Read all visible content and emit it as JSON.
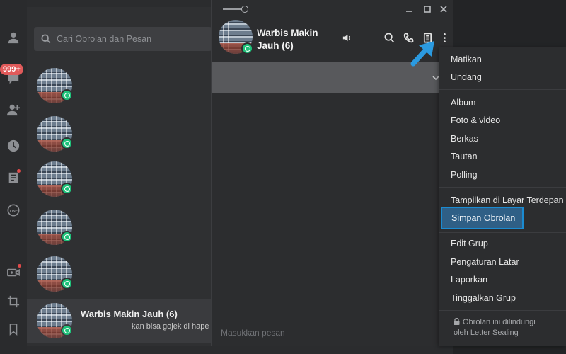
{
  "rail": {
    "badge": "999+",
    "icons": [
      "person-icon",
      "chat-icon",
      "add-friend-icon",
      "clock-icon",
      "timeline-icon",
      "line-icon",
      "video-call-icon",
      "crop-icon",
      "bookmark-icon"
    ]
  },
  "chat_list": {
    "search_placeholder": "Cari Obrolan dan Pesan",
    "items": [
      {
        "name": "",
        "preview": ""
      },
      {
        "name": "",
        "preview": ""
      },
      {
        "name": "",
        "preview": ""
      },
      {
        "name": "",
        "preview": ""
      },
      {
        "name": "",
        "preview": ""
      },
      {
        "name": "Warbis Makin Jauh (6)",
        "preview": "kan bisa gojek di hape l"
      }
    ]
  },
  "chat": {
    "title": "Warbis Makin Jauh (6)",
    "input_placeholder": "Masukkan pesan"
  },
  "menu": {
    "group1": [
      "Matikan",
      "Undang"
    ],
    "group2": [
      "Album",
      "Foto & video",
      "Berkas",
      "Tautan",
      "Polling"
    ],
    "group3": [
      "Tampilkan di Layar Terdepan",
      "Simpan Obrolan"
    ],
    "group4": [
      "Edit Grup",
      "Pengaturan Latar",
      "Laporkan",
      "Tinggalkan Grup"
    ],
    "sealing_line1": "Obrolan ini dilindungi",
    "sealing_line2": "oleh Letter Sealing"
  },
  "colors": {
    "highlight_border": "#1b8bd1",
    "arrow": "#2b9ae0",
    "group_badge": "#1fc27a",
    "notification": "#e05a5a"
  }
}
